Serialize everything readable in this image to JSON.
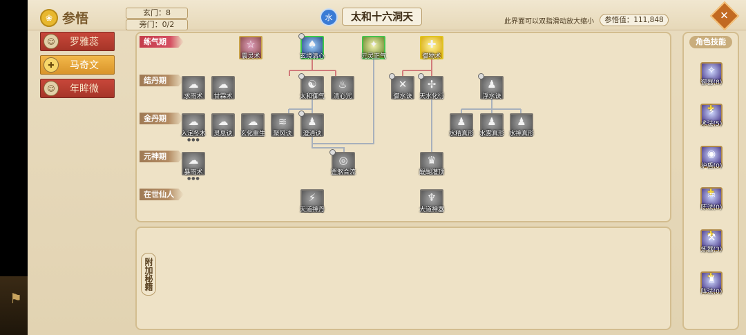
{
  "header": {
    "title": "参悟",
    "title_icon": "lotus-icon",
    "xuanmen": "玄门：8",
    "pangmen": "旁门：0/2",
    "element": "水",
    "realm_title": "太和十六洞天",
    "hint": "此界面可以双指滑动放大缩小",
    "score": "参悟值：111,848",
    "close_icon": "close-icon"
  },
  "characters": [
    {
      "name": "罗雅蕊",
      "active": false
    },
    {
      "name": "马奇文",
      "active": true
    },
    {
      "name": "年眸微",
      "active": false
    }
  ],
  "ranks": [
    "练气期",
    "结丹期",
    "金丹期",
    "元神期",
    "在世仙人"
  ],
  "nodes": [
    {
      "id": "n1",
      "label": "震灵术",
      "glyph": "☆"
    },
    {
      "id": "n2",
      "label": "玄境清心",
      "glyph": "♠"
    },
    {
      "id": "n3",
      "label": "元灵正气",
      "glyph": "✦"
    },
    {
      "id": "n4",
      "label": "御物术",
      "glyph": "✚"
    },
    {
      "id": "n5",
      "label": "求雨术",
      "glyph": "☁"
    },
    {
      "id": "n6",
      "label": "甘霖术",
      "glyph": "☁"
    },
    {
      "id": "n7",
      "label": "太和御气",
      "glyph": "☯"
    },
    {
      "id": "n8",
      "label": "清心咒",
      "glyph": "♨"
    },
    {
      "id": "n9",
      "label": "御水诀",
      "glyph": "✕"
    },
    {
      "id": "n10",
      "label": "天水化衍",
      "glyph": "✢"
    },
    {
      "id": "n11",
      "label": "浮水诀",
      "glyph": "♟"
    },
    {
      "id": "n12",
      "label": "入定冬木",
      "glyph": "☁"
    },
    {
      "id": "n13",
      "label": "灵息诀",
      "glyph": "☁"
    },
    {
      "id": "n14",
      "label": "玄化重生",
      "glyph": "☁"
    },
    {
      "id": "n15",
      "label": "聚风诀",
      "glyph": "≋"
    },
    {
      "id": "n16",
      "label": "澄清诀",
      "glyph": "♟"
    },
    {
      "id": "n17",
      "label": "水精真形",
      "glyph": "♟"
    },
    {
      "id": "n18",
      "label": "水雾真形",
      "glyph": "♟"
    },
    {
      "id": "n19",
      "label": "水神真形",
      "glyph": "♟"
    },
    {
      "id": "n20",
      "label": "暴雨术",
      "glyph": "☁"
    },
    {
      "id": "n21",
      "label": "罡煞合流",
      "glyph": "◎"
    },
    {
      "id": "n22",
      "label": "醍醐灌顶",
      "glyph": "♛"
    },
    {
      "id": "n23",
      "label": "天道神丹",
      "glyph": "⚡"
    },
    {
      "id": "n24",
      "label": "大道神器",
      "glyph": "♆"
    }
  ],
  "bonus": {
    "label": "附加秘籍"
  },
  "skills": {
    "title": "角色技能",
    "items": [
      {
        "label": "御器(8)",
        "glyph": "✧"
      },
      {
        "label": "术法(5)",
        "glyph": "⚡"
      },
      {
        "label": "护盾(0)",
        "glyph": "◉"
      },
      {
        "label": "陈法(0)",
        "glyph": "♒"
      },
      {
        "label": "炼器(3)",
        "glyph": "⚒"
      },
      {
        "label": "阵法(0)",
        "glyph": "♜"
      }
    ]
  }
}
